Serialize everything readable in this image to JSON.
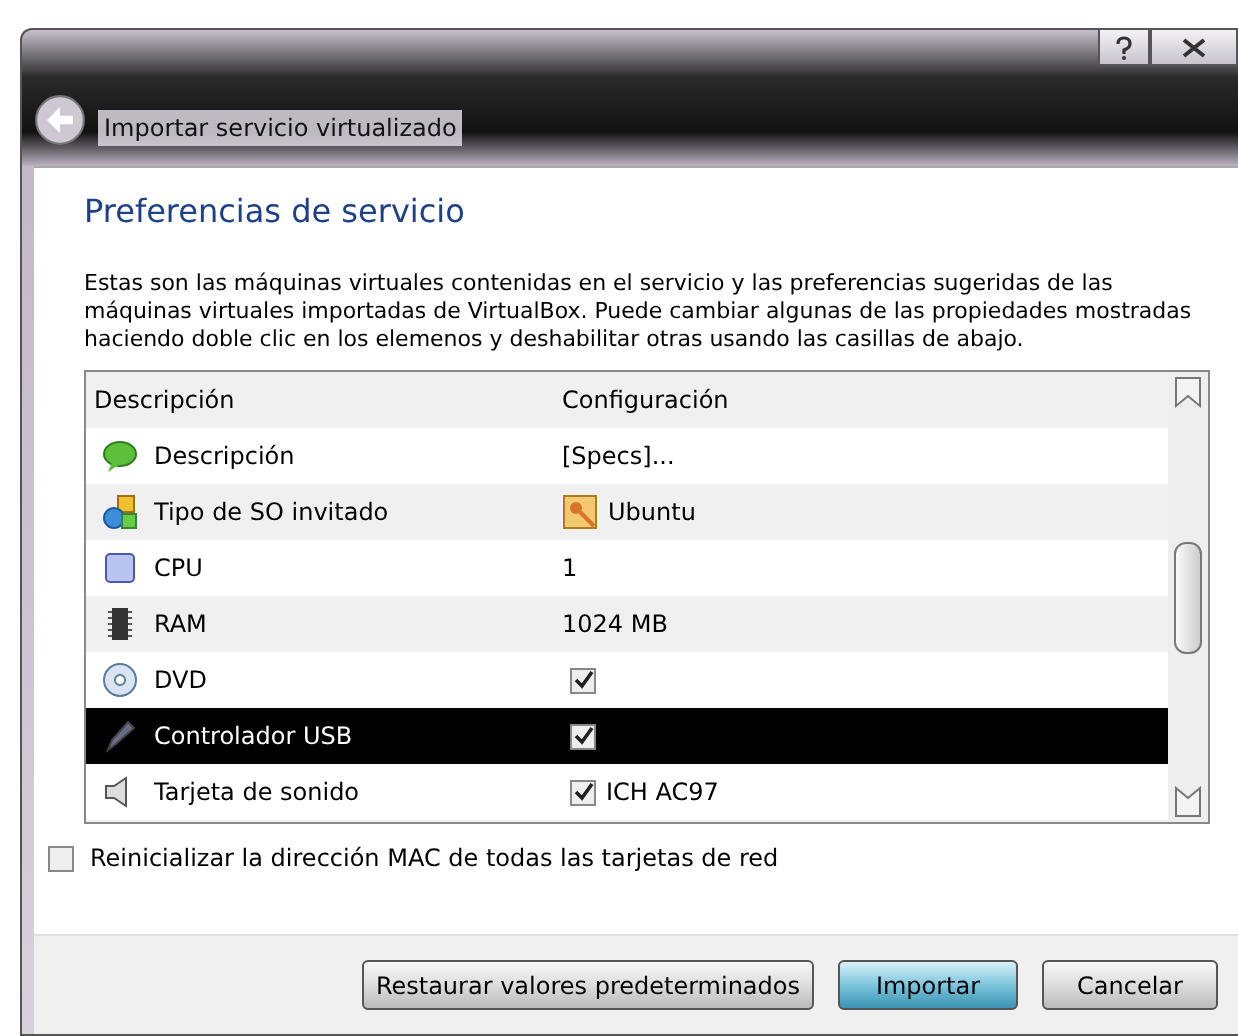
{
  "window": {
    "title": "Importar servicio virtualizado"
  },
  "heading": "Preferencias de servicio",
  "intro": "Estas son las máquinas virtuales contenidas en el servicio y las preferencias sugeridas de las máquinas virtuales importadas de VirtualBox. Puede cambiar algunas de las propiedades mostradas haciendo doble clic en los elemenos y deshabilitar otras usando las casillas de abajo.",
  "table": {
    "columns": [
      "Descripción",
      "Configuración"
    ],
    "rows": [
      {
        "label": "Descripción",
        "kind": "text",
        "value": "[Specs]...",
        "selected": false
      },
      {
        "label": "Tipo de SO invitado",
        "kind": "os",
        "value": "Ubuntu",
        "selected": false
      },
      {
        "label": "CPU",
        "kind": "text",
        "value": "1",
        "selected": false
      },
      {
        "label": "RAM",
        "kind": "text",
        "value": "1024 MB",
        "selected": false
      },
      {
        "label": "DVD",
        "kind": "checkbox",
        "checked": true,
        "selected": false
      },
      {
        "label": "Controlador USB",
        "kind": "checkbox",
        "checked": true,
        "selected": true
      },
      {
        "label": "Tarjeta de sonido",
        "kind": "checkbox",
        "checked": true,
        "value": "ICH AC97",
        "selected": false
      }
    ]
  },
  "mac_option": {
    "label": "Reinicializar la dirección MAC de todas las tarjetas de red",
    "checked": false
  },
  "buttons": [
    {
      "label": "Restaurar valores predeterminados",
      "kind": "normal"
    },
    {
      "label": "Importar",
      "kind": "default"
    },
    {
      "label": "Cancelar",
      "kind": "normal"
    }
  ]
}
